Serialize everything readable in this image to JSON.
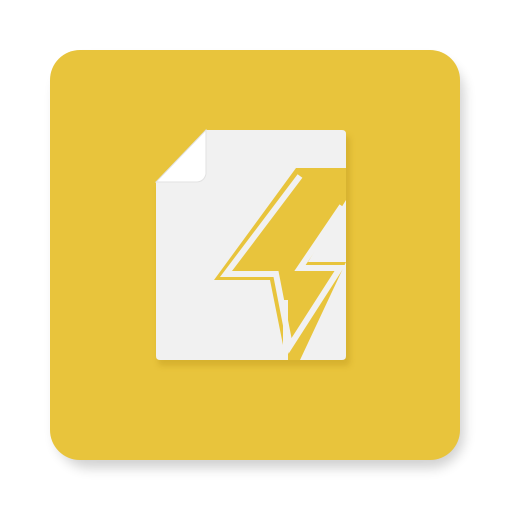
{
  "icon": {
    "name": "document-lightning-icon",
    "colors": {
      "background": "#ffffff",
      "tile": "#e8c43c",
      "tile_shadow": "#c9a524",
      "paper": "#f1f1f1",
      "paper_shadow": "#cfa92a",
      "fold": "#ffffff",
      "bolt": "#e8c43c",
      "bolt_outline": "#f1f1f1"
    }
  }
}
